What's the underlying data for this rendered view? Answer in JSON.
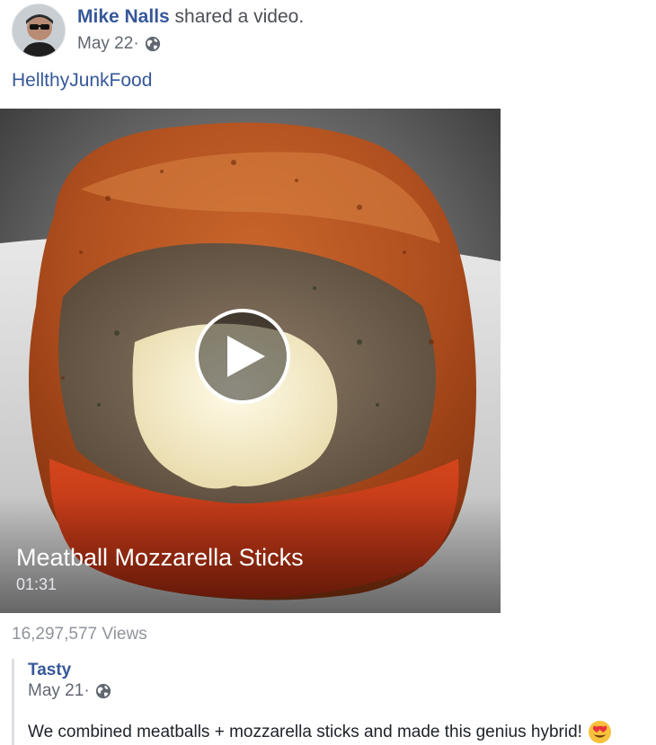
{
  "post": {
    "author_name": "Mike Nalls",
    "action_text": " shared a video.",
    "date": "May 22",
    "separator": " ·",
    "privacy_icon": "globe-icon",
    "hashtag": "HellthyJunkFood"
  },
  "video": {
    "title": "Meatball Mozzarella Sticks",
    "duration": "01:31",
    "play_icon": "play-icon",
    "views": "16,297,577 Views"
  },
  "shared_post": {
    "author_name": "Tasty",
    "date": "May 21",
    "separator": " ·",
    "privacy_icon": "globe-icon",
    "text": "We combined meatballs + mozzarella sticks and made this genius hybrid!",
    "emoji": "heart-eyes-emoji"
  },
  "colors": {
    "link": "#365899",
    "meta": "#616770",
    "muted": "#90949c"
  }
}
